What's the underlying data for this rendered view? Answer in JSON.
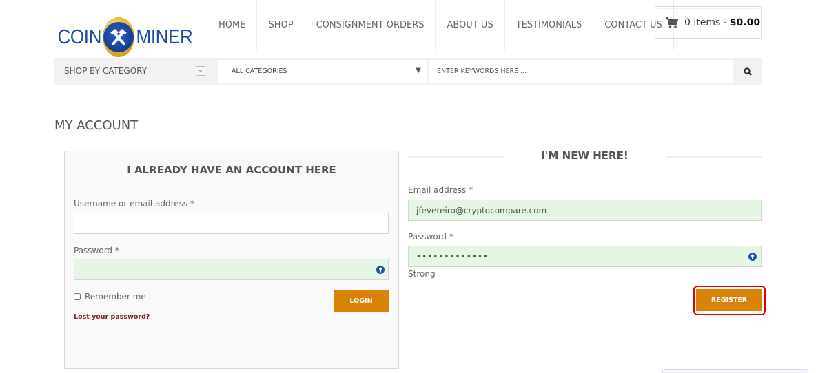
{
  "brand": {
    "word_left": "COIN",
    "word_right": "MINER",
    "logo_icon": "crossed-hammers-icon",
    "colors": {
      "blue": "#1c4fa0",
      "gold": "#e8b830"
    }
  },
  "nav": {
    "items": [
      {
        "label": "HOME"
      },
      {
        "label": "SHOP"
      },
      {
        "label": "CONSIGNMENT ORDERS"
      },
      {
        "label": "ABOUT US"
      },
      {
        "label": "TESTIMONIALS"
      },
      {
        "label": "CONTACT US"
      }
    ]
  },
  "cart": {
    "icon": "shopping-cart-icon",
    "items_text": "0 items -",
    "total": "$0.00"
  },
  "searchbar": {
    "category_label": "SHOP BY CATEGORY",
    "category_toggle_icon": "chevron-down-icon",
    "category_select_value": "ALL CATEGORIES",
    "select_arrow": "▼",
    "keyword_placeholder": "ENTER KEYWORDS HERE ...",
    "search_icon": "search-icon"
  },
  "page": {
    "title": "MY ACCOUNT"
  },
  "login": {
    "title": "I ALREADY HAVE AN ACCOUNT HERE",
    "username_label": "Username or email address *",
    "username_value": "",
    "password_label": "Password *",
    "password_value": "",
    "remember_label": "Remember me",
    "remember_checked": false,
    "login_button": "LOGIN",
    "lost_password_link": "Lost your password?"
  },
  "register": {
    "title": "I'M NEW HERE!",
    "email_label": "Email address *",
    "email_value": "jfevereiro@cryptocompare.com",
    "password_label": "Password *",
    "password_value": "•••••••••••••",
    "strength_text": "Strong",
    "register_button": "REGISTER"
  },
  "colors": {
    "accent_button": "#d98208",
    "autofill_bg": "#e6f6e4",
    "link": "#8b1b1b",
    "highlight": "#e00000",
    "key_icon": "#1a56a8"
  }
}
